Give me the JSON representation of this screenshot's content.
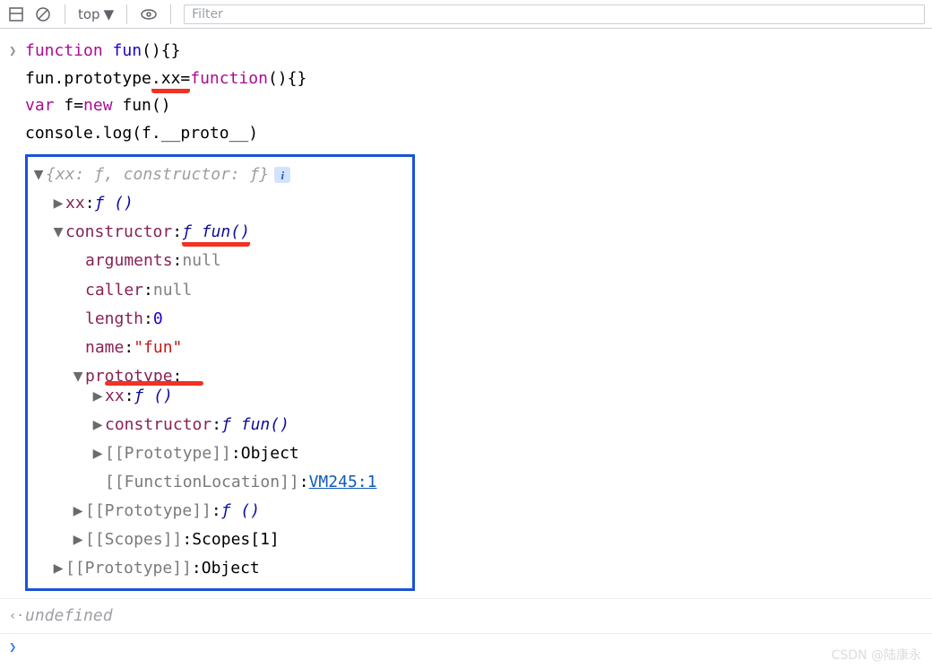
{
  "toolbar": {
    "context": "top",
    "filter_placeholder": "Filter"
  },
  "code": {
    "l1_kw": "function",
    "l1_name": " fun",
    "l1_rest": "(){}",
    "l2_pre": "fun.prototype",
    "l2_xx": ".xx=",
    "l2_fn": "function",
    "l2_rest": "(){}",
    "l3_var": "var",
    "l3_f": " f=",
    "l3_new": "new",
    "l3_call": " fun()",
    "l4": "console.log(f.__proto__)"
  },
  "tree": {
    "summary_pre": "{xx: ƒ, constructor: ƒ}",
    "xx_key": "xx",
    "xx_val": "ƒ ()",
    "constructor_key": "constructor",
    "constructor_val": "ƒ fun()",
    "arguments_key": "arguments",
    "arguments_val": "null",
    "caller_key": "caller",
    "caller_val": "null",
    "length_key": "length",
    "length_val": "0",
    "name_key": "name",
    "name_val": "\"fun\"",
    "prototype_key": "prototype",
    "proto_xx_key": "xx",
    "proto_xx_val": "ƒ ()",
    "proto_constructor_key": "constructor",
    "proto_constructor_val": "ƒ fun()",
    "proto_proto_key": "[[Prototype]]",
    "proto_proto_val": "Object",
    "fn_loc_key": "[[FunctionLocation]]",
    "fn_loc_val": "VM245:1",
    "ctor_proto_key": "[[Prototype]]",
    "ctor_proto_val": "ƒ ()",
    "scopes_key": "[[Scopes]]",
    "scopes_val": "Scopes[1]",
    "root_proto_key": "[[Prototype]]",
    "root_proto_val": "Object"
  },
  "output": {
    "undefined": "undefined"
  },
  "watermark": "CSDN @陆康永"
}
